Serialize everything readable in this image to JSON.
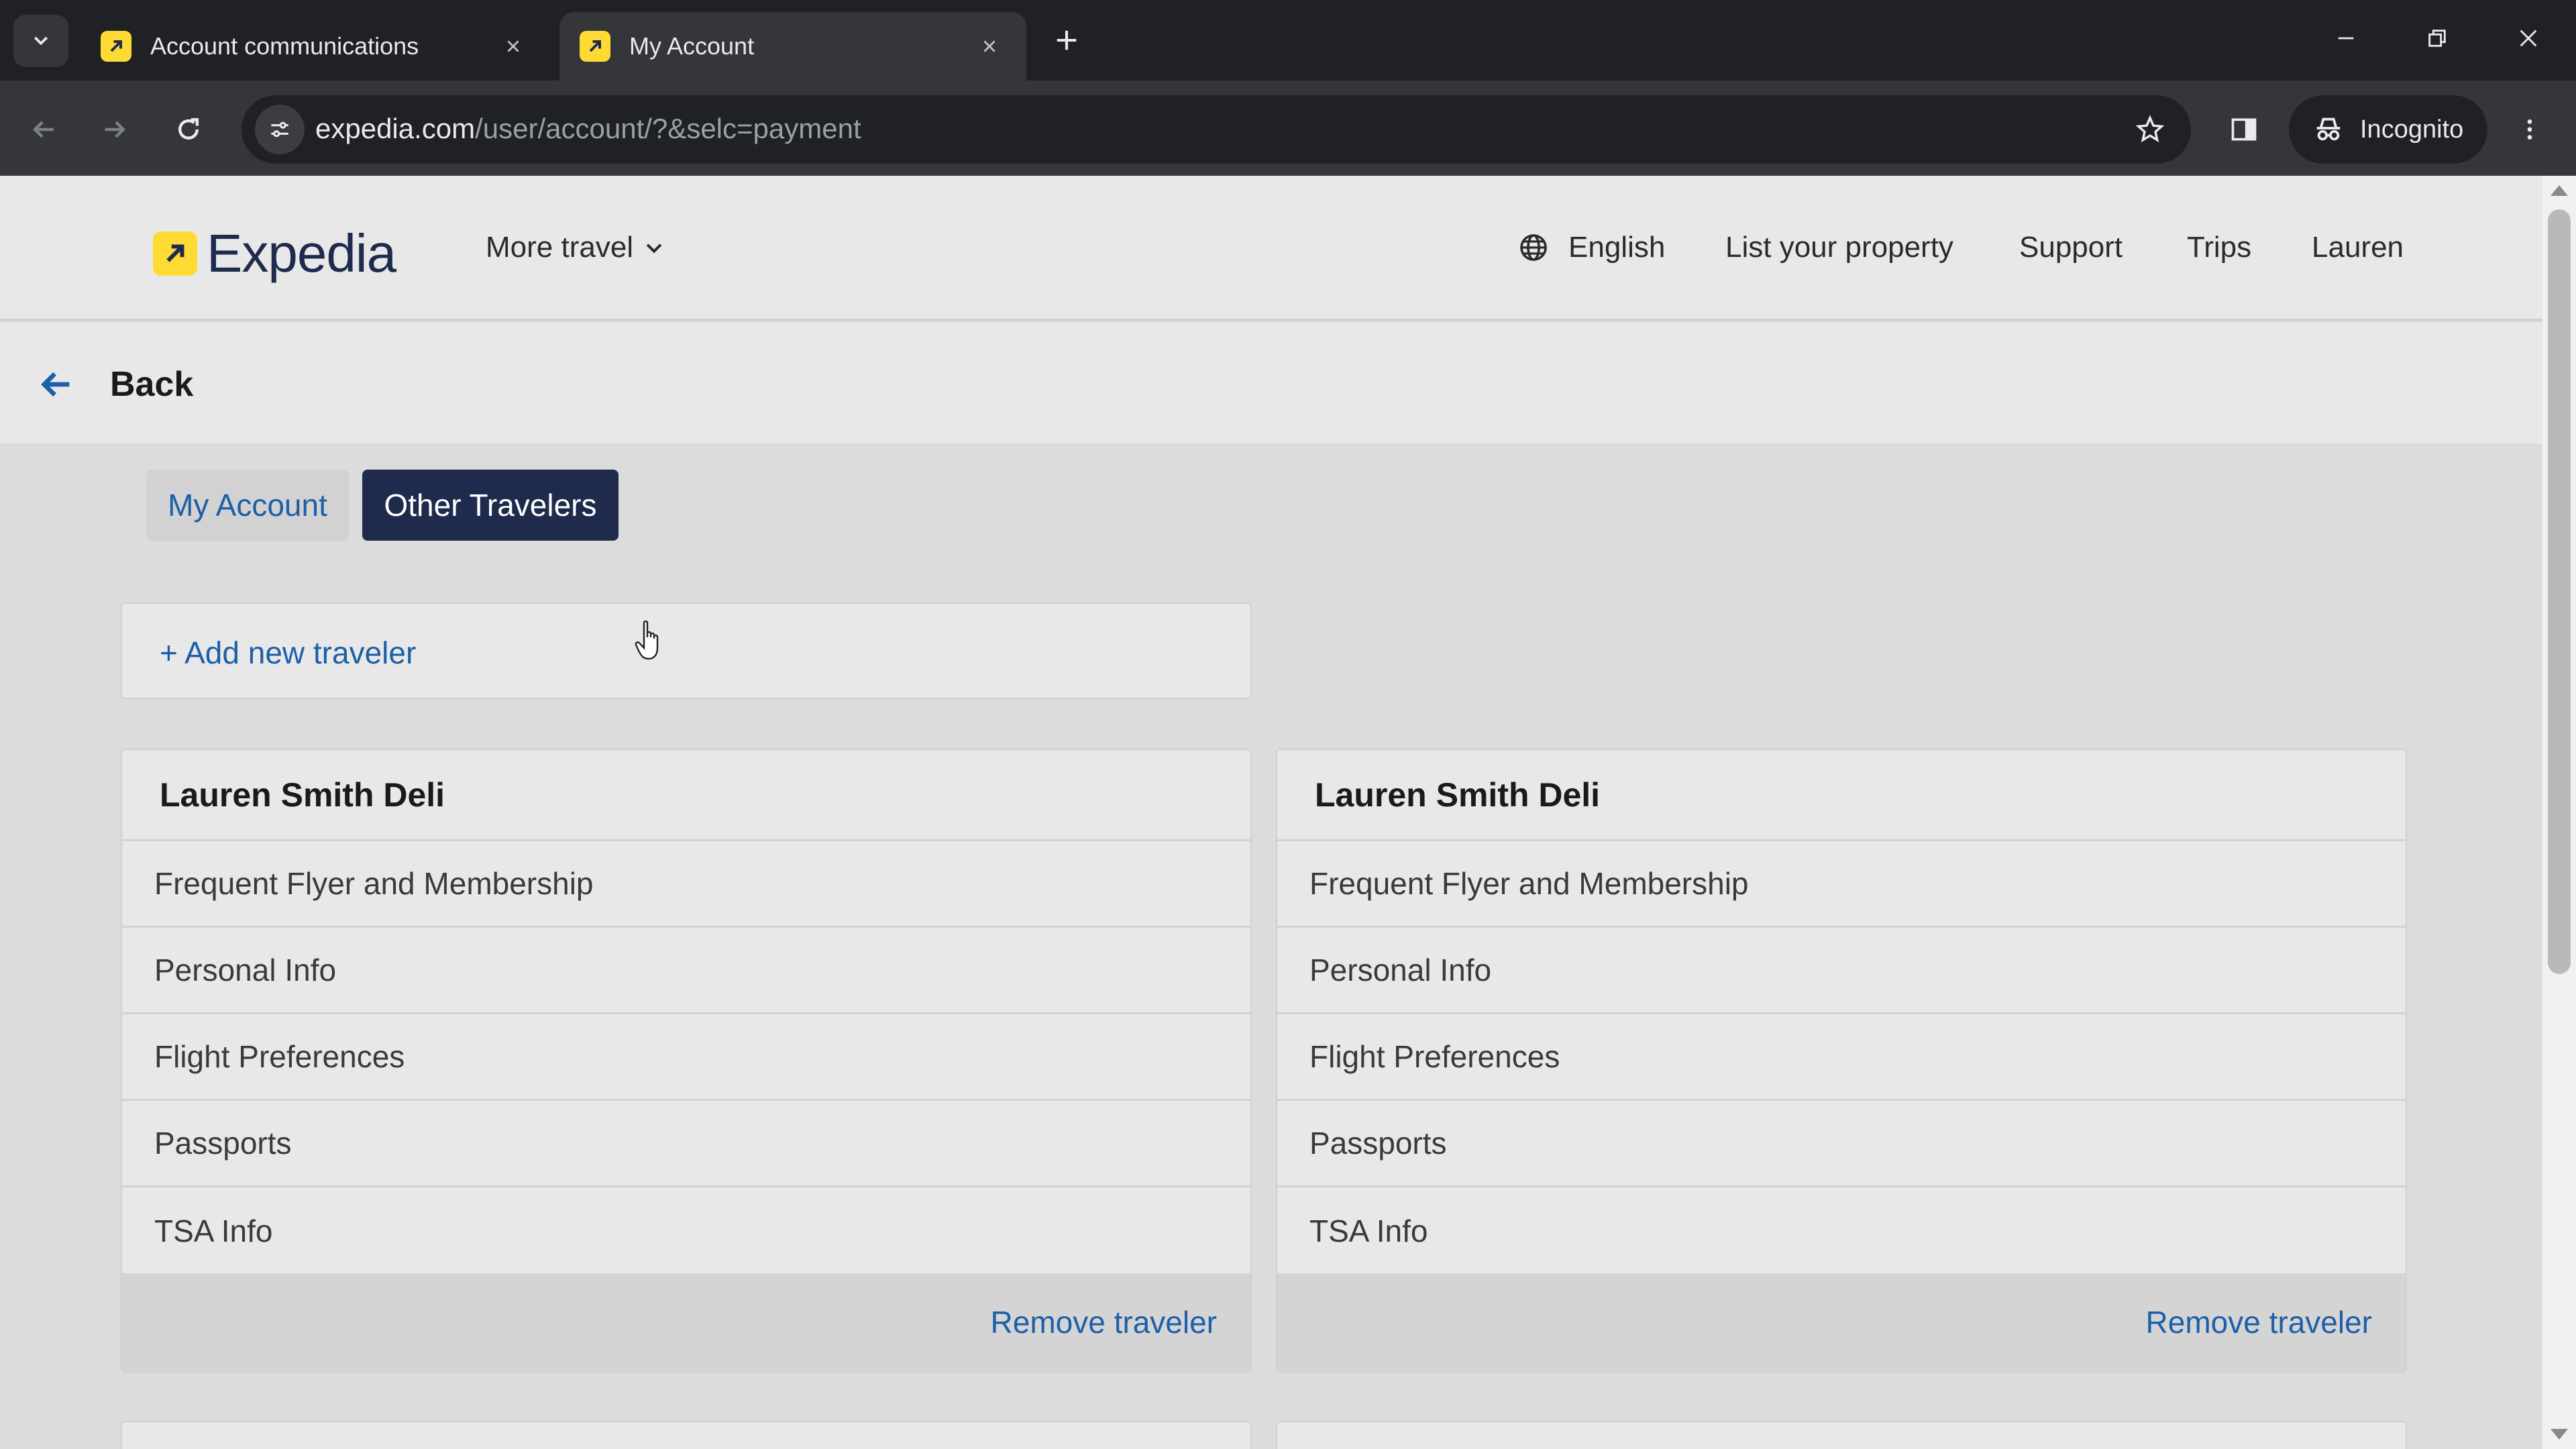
{
  "browser": {
    "tabs": [
      {
        "title": "Account communications",
        "active": false
      },
      {
        "title": "My Account",
        "active": true
      }
    ],
    "url_host": "expedia.com",
    "url_path": "/user/account/?&selc=payment",
    "incognito_label": "Incognito"
  },
  "header": {
    "logo_text": "Expedia",
    "more_travel": "More travel",
    "nav": {
      "language": "English",
      "list_property": "List your property",
      "support": "Support",
      "trips": "Trips",
      "user": "Lauren"
    }
  },
  "back_label": "Back",
  "segments": {
    "my_account": "My Account",
    "other_travelers": "Other Travelers"
  },
  "add_traveler": "+ Add new traveler",
  "travelers": [
    {
      "name": "Lauren Smith Deli",
      "sections": [
        "Frequent Flyer and Membership",
        "Personal Info",
        "Flight Preferences",
        "Passports",
        "TSA Info"
      ],
      "remove_label": "Remove traveler"
    },
    {
      "name": "Lauren Smith Deli",
      "sections": [
        "Frequent Flyer and Membership",
        "Personal Info",
        "Flight Preferences",
        "Passports",
        "TSA Info"
      ],
      "remove_label": "Remove traveler"
    }
  ],
  "colors": {
    "brand_yellow": "#fddb32",
    "brand_navy": "#1f2b4d",
    "link_blue": "#1d5fa8"
  }
}
